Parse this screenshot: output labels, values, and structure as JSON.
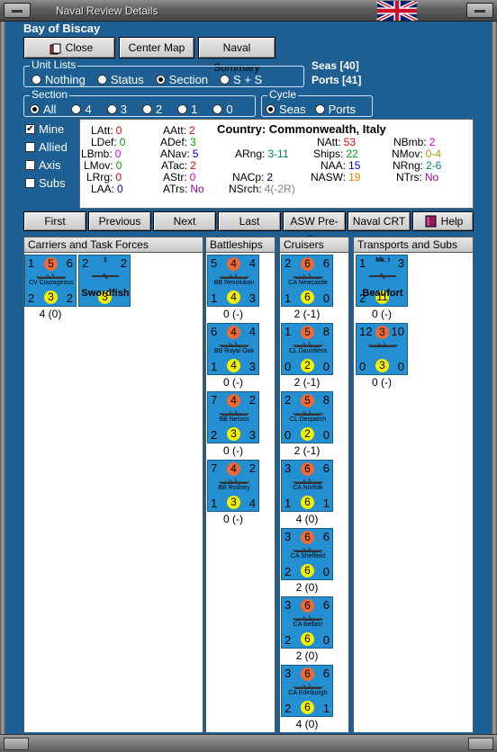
{
  "window": {
    "title": "Naval Review Details"
  },
  "sea_name": "Bay of Biscay",
  "buttons": {
    "close": "Close",
    "center_map": "Center Map",
    "naval_summary": "Naval Summary"
  },
  "unit_lists": {
    "label": "Unit Lists",
    "options": [
      "Nothing",
      "Status",
      "Section",
      "S + S"
    ],
    "selected": "Section"
  },
  "seas_count": "Seas [40]",
  "ports_count": "Ports [41]",
  "section": {
    "label": "Section",
    "options": [
      "All",
      "4",
      "3",
      "2",
      "1",
      "0"
    ],
    "selected": "All"
  },
  "cycle": {
    "label": "Cycle",
    "options": [
      "Seas",
      "Ports"
    ],
    "selected": "Seas"
  },
  "filters": [
    {
      "label": "Mine",
      "checked": true
    },
    {
      "label": "Allied",
      "checked": false
    },
    {
      "label": "Axis",
      "checked": false
    },
    {
      "label": "Subs",
      "checked": false
    }
  ],
  "country": "Country: Commonwealth, Italy",
  "stats": {
    "latt": {
      "k": "LAtt:",
      "v": "0",
      "c": "#e00000"
    },
    "ldef": {
      "k": "LDef:",
      "v": "0",
      "c": "#00a000"
    },
    "lbmb": {
      "k": "LBmb:",
      "v": "0",
      "c": "#d000d0"
    },
    "lmov": {
      "k": "LMov:",
      "v": "0",
      "c": "#00a000"
    },
    "lrrg": {
      "k": "LRrg:",
      "v": "0",
      "c": "#e00000"
    },
    "laa": {
      "k": "LAA:",
      "v": "0",
      "c": "#0000d0"
    },
    "aatt": {
      "k": "AAtt:",
      "v": "2",
      "c": "#e00000"
    },
    "adef": {
      "k": "ADef:",
      "v": "3",
      "c": "#00a000"
    },
    "anav": {
      "k": "ANav:",
      "v": "5",
      "c": "#0000d0"
    },
    "atac": {
      "k": "ATac:",
      "v": "2",
      "c": "#e00000"
    },
    "astr": {
      "k": "AStr:",
      "v": "0",
      "c": "#d000d0"
    },
    "atrs": {
      "k": "ATrs:",
      "v": "No",
      "c": "#a000a0"
    },
    "arng": {
      "k": "ARng:",
      "v": "3-11",
      "c": "#008080"
    },
    "nacp": {
      "k": "NACp:",
      "v": "2",
      "c": "#000080"
    },
    "nsrch": {
      "k": "NSrch:",
      "v": "4(-2R)",
      "c": "#808080"
    },
    "natt": {
      "k": "NAtt:",
      "v": "53",
      "c": "#e00000"
    },
    "ships": {
      "k": "Ships:",
      "v": "22",
      "c": "#00a000"
    },
    "naa": {
      "k": "NAA:",
      "v": "15",
      "c": "#0000d0"
    },
    "nasw": {
      "k": "NASW:",
      "v": "19",
      "c": "#e08000"
    },
    "nbmb": {
      "k": "NBmb:",
      "v": "2",
      "c": "#d000d0"
    },
    "nmov": {
      "k": "NMov:",
      "v": "0-4",
      "c": "#a0a000"
    },
    "nrng": {
      "k": "NRng:",
      "v": "2-6",
      "c": "#008080"
    },
    "ntrs": {
      "k": "NTrs:",
      "v": "No",
      "c": "#a000a0"
    }
  },
  "nav": {
    "first": "First",
    "previous": "Previous",
    "next": "Next",
    "last": "Last",
    "asw": "ASW Pre-fire",
    "crt": "Naval CRT",
    "help": "Help"
  },
  "columns": {
    "carriers": {
      "header": "Carriers and Task Forces",
      "units": [
        {
          "name": "CV Courageous",
          "tl": "1",
          "tr": "6",
          "top": "5",
          "bl": "2",
          "bot": "3",
          "br": "2",
          "below": "4 (0)"
        },
        {
          "name": "Swordfish",
          "tl": "2",
          "tr": "2",
          "top": "1",
          "bl": "",
          "bot": "3",
          "br": "",
          "below": ""
        }
      ]
    },
    "battleships": {
      "header": "Battleships",
      "units": [
        {
          "name": "BB Resolution",
          "tl": "5",
          "tr": "4",
          "top": "4",
          "bl": "1",
          "bot": "4",
          "br": "3",
          "below": "0 (-)"
        },
        {
          "name": "BB Royal Oak",
          "tl": "6",
          "tr": "4",
          "top": "4",
          "bl": "1",
          "bot": "4",
          "br": "3",
          "below": "0 (-)"
        },
        {
          "name": "BB Nelson",
          "tl": "7",
          "tr": "2",
          "top": "4",
          "bl": "2",
          "bot": "3",
          "br": "3",
          "below": "0 (-)"
        },
        {
          "name": "BB Rodney",
          "tl": "7",
          "tr": "2",
          "top": "4",
          "bl": "1",
          "bot": "3",
          "br": "4",
          "below": "0 (-)"
        }
      ]
    },
    "cruisers": {
      "header": "Cruisers",
      "units": [
        {
          "name": "CA Newcastle",
          "tl": "2",
          "tr": "6",
          "top": "6",
          "bl": "1",
          "bot": "6",
          "br": "0",
          "below": "2 (-1)"
        },
        {
          "name": "CL Dauntless",
          "tl": "1",
          "tr": "8",
          "top": "5",
          "bl": "0",
          "bot": "2",
          "br": "0",
          "below": "2 (-1)"
        },
        {
          "name": "CL Despatch",
          "tl": "2",
          "tr": "8",
          "top": "5",
          "bl": "0",
          "bot": "2",
          "br": "0",
          "below": "2 (-1)"
        },
        {
          "name": "CA Norfolk",
          "tl": "3",
          "tr": "6",
          "top": "6",
          "bl": "1",
          "bot": "6",
          "br": "1",
          "below": "4 (0)"
        },
        {
          "name": "CA Sheffield",
          "tl": "3",
          "tr": "6",
          "top": "6",
          "bl": "2",
          "bot": "6",
          "br": "0",
          "below": "2 (0)"
        },
        {
          "name": "CA Belfast",
          "tl": "3",
          "tr": "6",
          "top": "6",
          "bl": "2",
          "bot": "6",
          "br": "0",
          "below": "2 (0)"
        },
        {
          "name": "CA Edinburgh",
          "tl": "3",
          "tr": "6",
          "top": "6",
          "bl": "2",
          "bot": "6",
          "br": "1",
          "below": "4 (0)"
        }
      ]
    },
    "transports": {
      "header": "Transports and Subs",
      "units": [
        {
          "name": "Beaufort",
          "tl": "1",
          "tr": "3",
          "top": "Mk. I",
          "bl": "2",
          "bot": "11",
          "br": "",
          "below": "0 (-)"
        },
        {
          "name": "",
          "tl": "12",
          "tr": "10",
          "top": "3",
          "bl": "0",
          "bot": "3",
          "br": "0",
          "below": "0 (-)"
        }
      ]
    }
  }
}
